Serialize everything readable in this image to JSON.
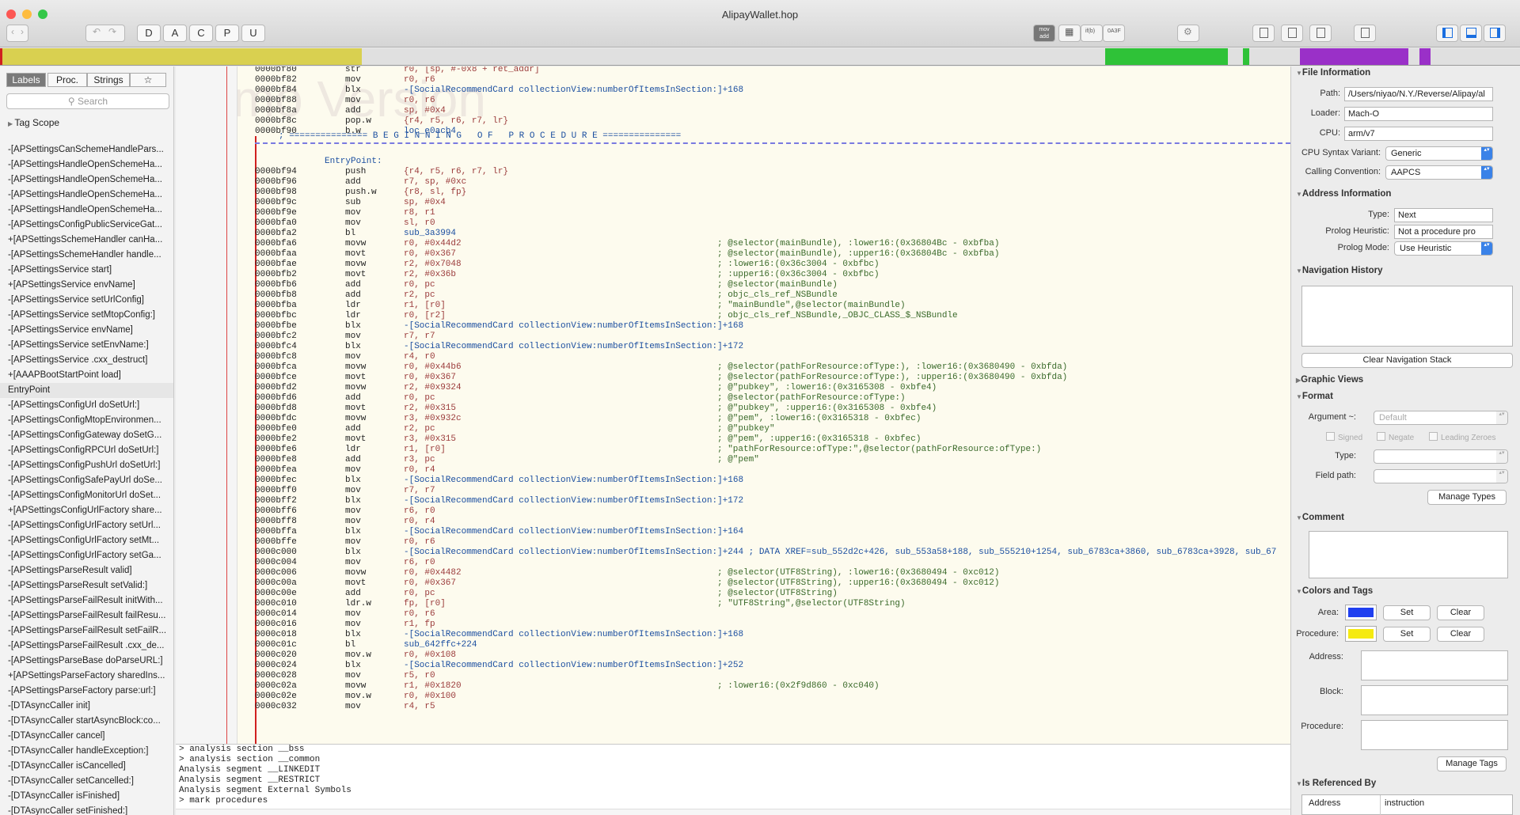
{
  "window": {
    "title": "AlipayWallet.hop"
  },
  "toolbar": {
    "buttons": [
      "D",
      "A",
      "C",
      "P",
      "U"
    ],
    "mov_add": "mov add"
  },
  "colors": {
    "nav_yellow": "#d9d050",
    "nav_green": "#2fc238",
    "nav_purple": "#9a30c8",
    "area_color": "#1f3ff0",
    "procedure_color": "#f5ea10"
  },
  "left": {
    "tabs": [
      "Labels",
      "Proc.",
      "Strings",
      "☆"
    ],
    "search_placeholder": "Search",
    "tag_scope": "Tag Scope",
    "watermark": "Demo Version",
    "labels": [
      "-[APSettingsCanSchemeHandlePars...",
      "-[APSettingsHandleOpenSchemeHa...",
      "-[APSettingsHandleOpenSchemeHa...",
      "-[APSettingsHandleOpenSchemeHa...",
      "-[APSettingsHandleOpenSchemeHa...",
      "-[APSettingsConfigPublicServiceGat...",
      "+[APSettingsSchemeHandler canHa...",
      "-[APSettingsSchemeHandler handle...",
      "-[APSettingsService start]",
      "+[APSettingsService envName]",
      "-[APSettingsService setUrlConfig]",
      "-[APSettingsService setMtopConfig:]",
      "-[APSettingsService envName]",
      "-[APSettingsService setEnvName:]",
      "-[APSettingsService .cxx_destruct]",
      "+[AAAPBootStartPoint load]",
      "EntryPoint",
      "-[APSettingsConfigUrl doSetUrl:]",
      "-[APSettingsConfigMtopEnvironmen...",
      "-[APSettingsConfigGateway doSetG...",
      "-[APSettingsConfigRPCUrl doSetUrl:]",
      "-[APSettingsConfigPushUrl doSetUrl:]",
      "-[APSettingsConfigSafePayUrl doSe...",
      "-[APSettingsConfigMonitorUrl doSet...",
      "+[APSettingsConfigUrlFactory share...",
      "-[APSettingsConfigUrlFactory setUrl...",
      "-[APSettingsConfigUrlFactory setMt...",
      "-[APSettingsConfigUrlFactory setGa...",
      "-[APSettingsParseResult valid]",
      "-[APSettingsParseResult setValid:]",
      "-[APSettingsParseFailResult initWith...",
      "-[APSettingsParseFailResult failResu...",
      "-[APSettingsParseFailResult setFailR...",
      "-[APSettingsParseFailResult .cxx_de...",
      "-[APSettingsParseBase doParseURL:]",
      "+[APSettingsParseFactory sharedIns...",
      "-[APSettingsParseFactory parse:url:]",
      "-[DTAsyncCaller init]",
      "-[DTAsyncCaller startAsyncBlock:co...",
      "-[DTAsyncCaller cancel]",
      "-[DTAsyncCaller handleException:]",
      "-[DTAsyncCaller isCancelled]",
      "-[DTAsyncCaller setCancelled:]",
      "-[DTAsyncCaller isFinished]",
      "-[DTAsyncCaller setFinished:]"
    ]
  },
  "code": {
    "pre_lines": [
      [
        "0000bf80",
        "str",
        "r0, [sp, #-0x8 + ret_addr]",
        ""
      ],
      [
        "0000bf82",
        "mov",
        "r0, r6",
        ""
      ],
      [
        "0000bf84",
        "blx",
        "-[SocialRecommendCard collectionView:numberOfItemsInSection:]+168",
        ""
      ],
      [
        "0000bf88",
        "mov",
        "r0, r6",
        ""
      ],
      [
        "0000bf8a",
        "add",
        "sp, #0x4",
        ""
      ],
      [
        "0000bf8c",
        "pop.w",
        "{r4, r5, r6, r7, lr}",
        ""
      ],
      [
        "0000bf90",
        "b.w",
        "loc_e0acb4",
        ""
      ]
    ],
    "banner": "; =============== B E G I N N I N G   O F   P R O C E D U R E ===============",
    "entry_label": "EntryPoint:",
    "lines": [
      [
        "0000bf94",
        "push",
        "{r4, r5, r6, r7, lr}",
        ""
      ],
      [
        "0000bf96",
        "add",
        "r7, sp, #0xc",
        ""
      ],
      [
        "0000bf98",
        "push.w",
        "{r8, sl, fp}",
        ""
      ],
      [
        "0000bf9c",
        "sub",
        "sp, #0x4",
        ""
      ],
      [
        "0000bf9e",
        "mov",
        "r8, r1",
        ""
      ],
      [
        "0000bfa0",
        "mov",
        "sl, r0",
        ""
      ],
      [
        "0000bfa2",
        "bl",
        "sub_3a3994",
        ""
      ],
      [
        "0000bfa6",
        "movw",
        "r0, #0x44d2",
        "; @selector(mainBundle), :lower16:(0x36804Bc - 0xbfba)"
      ],
      [
        "0000bfaa",
        "movt",
        "r0, #0x367",
        "; @selector(mainBundle), :upper16:(0x36804Bc - 0xbfba)"
      ],
      [
        "0000bfae",
        "movw",
        "r2, #0x7048",
        "; :lower16:(0x36c3004 - 0xbfbc)"
      ],
      [
        "0000bfb2",
        "movt",
        "r2, #0x36b",
        "; :upper16:(0x36c3004 - 0xbfbc)"
      ],
      [
        "0000bfb6",
        "add",
        "r0, pc",
        "; @selector(mainBundle)"
      ],
      [
        "0000bfb8",
        "add",
        "r2, pc",
        "; objc_cls_ref_NSBundle"
      ],
      [
        "0000bfba",
        "ldr",
        "r1, [r0]",
        "; \"mainBundle\",@selector(mainBundle)"
      ],
      [
        "0000bfbc",
        "ldr",
        "r0, [r2]",
        "; objc_cls_ref_NSBundle,_OBJC_CLASS_$_NSBundle"
      ],
      [
        "0000bfbe",
        "blx",
        "-[SocialRecommendCard collectionView:numberOfItemsInSection:]+168",
        ""
      ],
      [
        "0000bfc2",
        "mov",
        "r7, r7",
        ""
      ],
      [
        "0000bfc4",
        "blx",
        "-[SocialRecommendCard collectionView:numberOfItemsInSection:]+172",
        ""
      ],
      [
        "0000bfc8",
        "mov",
        "r4, r0",
        ""
      ],
      [
        "0000bfca",
        "movw",
        "r0, #0x44b6",
        "; @selector(pathForResource:ofType:), :lower16:(0x3680490 - 0xbfda)"
      ],
      [
        "0000bfce",
        "movt",
        "r0, #0x367",
        "; @selector(pathForResource:ofType:), :upper16:(0x3680490 - 0xbfda)"
      ],
      [
        "0000bfd2",
        "movw",
        "r2, #0x9324",
        "; @\"pubkey\", :lower16:(0x3165308 - 0xbfe4)"
      ],
      [
        "0000bfd6",
        "add",
        "r0, pc",
        "; @selector(pathForResource:ofType:)"
      ],
      [
        "0000bfd8",
        "movt",
        "r2, #0x315",
        "; @\"pubkey\", :upper16:(0x3165308 - 0xbfe4)"
      ],
      [
        "0000bfdc",
        "movw",
        "r3, #0x932c",
        "; @\"pem\", :lower16:(0x3165318 - 0xbfec)"
      ],
      [
        "0000bfe0",
        "add",
        "r2, pc",
        "; @\"pubkey\""
      ],
      [
        "0000bfe2",
        "movt",
        "r3, #0x315",
        "; @\"pem\", :upper16:(0x3165318 - 0xbfec)"
      ],
      [
        "0000bfe6",
        "ldr",
        "r1, [r0]",
        "; \"pathForResource:ofType:\",@selector(pathForResource:ofType:)"
      ],
      [
        "0000bfe8",
        "add",
        "r3, pc",
        "; @\"pem\""
      ],
      [
        "0000bfea",
        "mov",
        "r0, r4",
        ""
      ],
      [
        "0000bfec",
        "blx",
        "-[SocialRecommendCard collectionView:numberOfItemsInSection:]+168",
        ""
      ],
      [
        "0000bff0",
        "mov",
        "r7, r7",
        ""
      ],
      [
        "0000bff2",
        "blx",
        "-[SocialRecommendCard collectionView:numberOfItemsInSection:]+172",
        ""
      ],
      [
        "0000bff6",
        "mov",
        "r6, r0",
        ""
      ],
      [
        "0000bff8",
        "mov",
        "r0, r4",
        ""
      ],
      [
        "0000bffa",
        "blx",
        "-[SocialRecommendCard collectionView:numberOfItemsInSection:]+164",
        ""
      ],
      [
        "0000bffe",
        "mov",
        "r0, r6",
        ""
      ],
      [
        "0000c000",
        "blx",
        "-[SocialRecommendCard collectionView:numberOfItemsInSection:]+244 ; DATA XREF=sub_552d2c+426, sub_553a58+188, sub_555210+1254, sub_6783ca+3860, sub_6783ca+3928, sub_67",
        ""
      ],
      [
        "0000c004",
        "mov",
        "r6, r0",
        ""
      ],
      [
        "0000c006",
        "movw",
        "r0, #0x4482",
        "; @selector(UTF8String), :lower16:(0x3680494 - 0xc012)"
      ],
      [
        "0000c00a",
        "movt",
        "r0, #0x367",
        "; @selector(UTF8String), :upper16:(0x3680494 - 0xc012)"
      ],
      [
        "0000c00e",
        "add",
        "r0, pc",
        "; @selector(UTF8String)"
      ],
      [
        "0000c010",
        "ldr.w",
        "fp, [r0]",
        "; \"UTF8String\",@selector(UTF8String)"
      ],
      [
        "0000c014",
        "mov",
        "r0, r6",
        ""
      ],
      [
        "0000c016",
        "mov",
        "r1, fp",
        ""
      ],
      [
        "0000c018",
        "blx",
        "-[SocialRecommendCard collectionView:numberOfItemsInSection:]+168",
        ""
      ],
      [
        "0000c01c",
        "bl",
        "sub_642ffc+224",
        ""
      ],
      [
        "0000c020",
        "mov.w",
        "r0, #0x108",
        ""
      ],
      [
        "0000c024",
        "blx",
        "-[SocialRecommendCard collectionView:numberOfItemsInSection:]+252",
        ""
      ],
      [
        "0000c028",
        "mov",
        "r5, r0",
        ""
      ],
      [
        "0000c02a",
        "movw",
        "r1, #0x1820",
        "; :lower16:(0x2f9d860 - 0xc040)"
      ],
      [
        "0000c02e",
        "mov.w",
        "r0, #0x100",
        ""
      ],
      [
        "0000c032",
        "mov",
        "r4, r5",
        ""
      ]
    ]
  },
  "console": {
    "lines": [
      "> analysis section __bss",
      "> analysis section __common",
      "Analysis segment __LINKEDIT",
      "Analysis segment __RESTRICT",
      "Analysis segment External Symbols",
      "> mark procedures"
    ]
  },
  "right": {
    "file_info": {
      "title": "File Information",
      "path_label": "Path:",
      "path": "/Users/niyao/N.Y./Reverse/Alipay/al",
      "loader_label": "Loader:",
      "loader": "Mach-O",
      "cpu_label": "CPU:",
      "cpu": "arm/v7",
      "syntax_label": "CPU Syntax Variant:",
      "syntax": "Generic",
      "calling_label": "Calling Convention:",
      "calling": "AAPCS"
    },
    "addr_info": {
      "title": "Address Information",
      "type_label": "Type:",
      "type": "Next",
      "prolog_label": "Prolog Heuristic:",
      "prolog": "Not a procedure pro",
      "mode_label": "Prolog Mode:",
      "mode": "Use Heuristic"
    },
    "nav_history": {
      "title": "Navigation History",
      "clear": "Clear Navigation Stack"
    },
    "graphic_views": {
      "title": "Graphic Views"
    },
    "format": {
      "title": "Format",
      "arg_label": "Argument ~:",
      "arg": "Default",
      "signed": "Signed",
      "negate": "Negate",
      "leading": "Leading Zeroes",
      "type_label": "Type:",
      "field_label": "Field path:",
      "manage": "Manage Types"
    },
    "comment": {
      "title": "Comment"
    },
    "colors_tags": {
      "title": "Colors and Tags",
      "area_label": "Area:",
      "procedure_label": "Procedure:",
      "set": "Set",
      "clear": "Clear",
      "address_label": "Address:",
      "block_label": "Block:",
      "proc_label": "Procedure:",
      "manage": "Manage Tags"
    },
    "referenced": {
      "title": "Is Referenced By",
      "col_address": "Address",
      "col_instruction": "instruction"
    }
  }
}
